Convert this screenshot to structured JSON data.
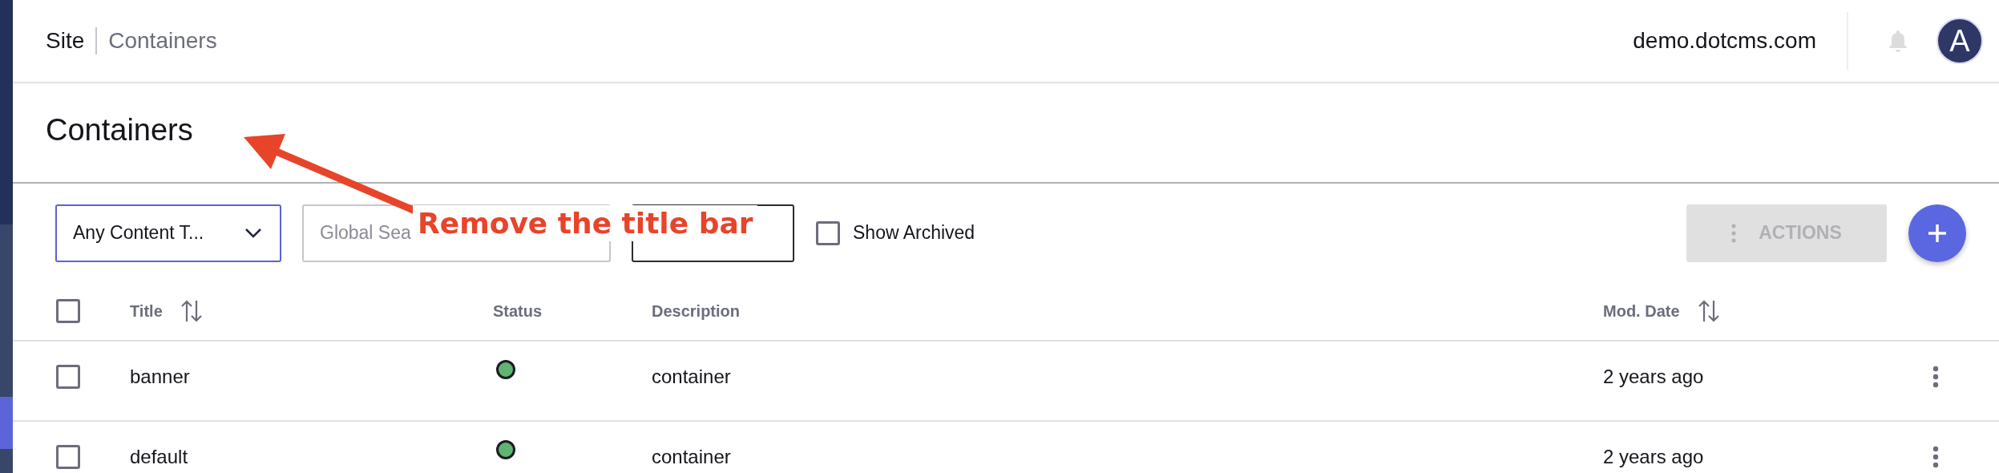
{
  "breadcrumb": {
    "site": "Site",
    "current": "Containers"
  },
  "header": {
    "host": "demo.dotcms.com",
    "avatar": "A"
  },
  "page_title": "Containers",
  "toolbar": {
    "content_type": "Any Content T...",
    "search": {
      "placeholder": "Global Sea"
    },
    "show_archived": {
      "label": "Show Archived",
      "checked": false
    },
    "actions": {
      "label": "ACTIONS",
      "disabled": true
    }
  },
  "table": {
    "select_all": {
      "checked": false
    },
    "columns": [
      {
        "label": "Title",
        "sortable": true
      },
      {
        "label": "Status",
        "sortable": false
      },
      {
        "label": "Description",
        "sortable": false
      },
      {
        "label": "Mod. Date",
        "sortable": true
      }
    ],
    "rows": [
      {
        "checked": false,
        "title": "banner",
        "color": "#5fb56f",
        "description": "container",
        "mod_date": "2 years ago"
      },
      {
        "checked": false,
        "title": "default",
        "color": "#5fb56f",
        "description": "container",
        "mod_date": "2 years ago"
      }
    ]
  },
  "annotation": {
    "text": "Remove the title bar"
  }
}
